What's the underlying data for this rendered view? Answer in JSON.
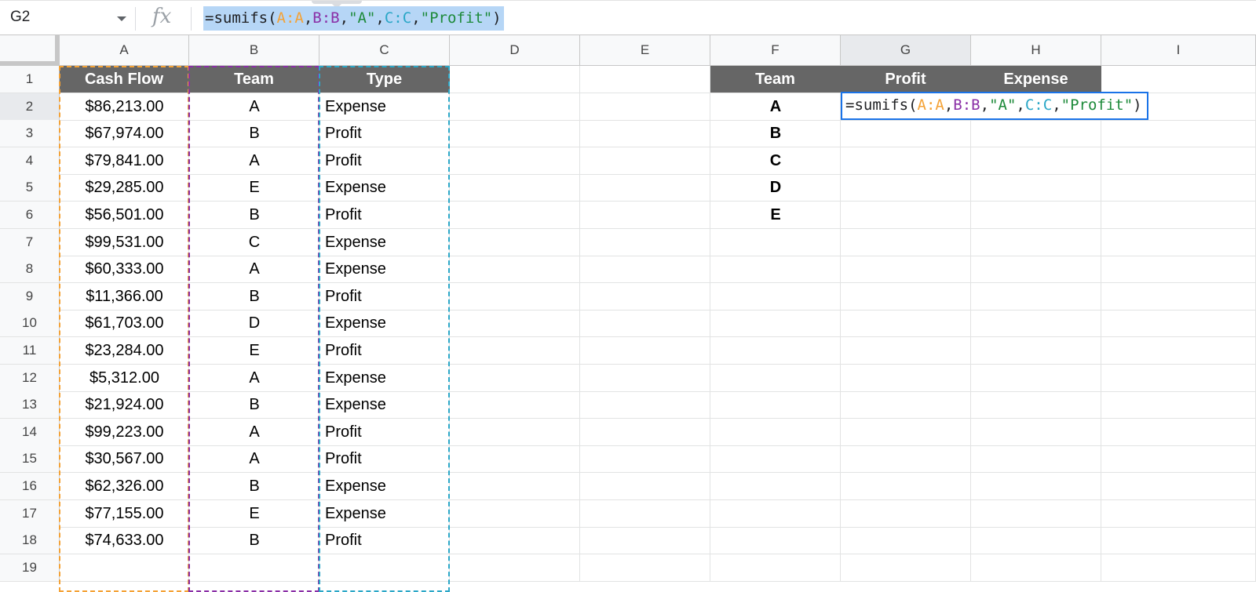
{
  "formula_bar": {
    "cell_ref": "G2",
    "fx_label": "fx",
    "formula_parts": [
      {
        "text": "=sumifs(",
        "color": "bk"
      },
      {
        "text": "A:A",
        "color": "or"
      },
      {
        "text": ",",
        "color": "bk"
      },
      {
        "text": "B:B",
        "color": "pu"
      },
      {
        "text": ",",
        "color": "bk"
      },
      {
        "text": "\"A\"",
        "color": "gr"
      },
      {
        "text": ",",
        "color": "bk"
      },
      {
        "text": "C:C",
        "color": "tl"
      },
      {
        "text": ",",
        "color": "bk"
      },
      {
        "text": "\"Profit\"",
        "color": "gr"
      },
      {
        "text": ")",
        "color": "bk"
      }
    ]
  },
  "colors": {
    "header_fill": "#666666",
    "range_a": "#f4a236",
    "range_b": "#8a2fa6",
    "range_c": "#2ba7c7",
    "active": "#1a73e8"
  },
  "columns": [
    "A",
    "B",
    "C",
    "D",
    "E",
    "F",
    "G",
    "H",
    "I"
  ],
  "selected_column": "G",
  "rows": [
    "1",
    "2",
    "3",
    "4",
    "5",
    "6",
    "7",
    "8",
    "9",
    "10",
    "11",
    "12",
    "13",
    "14",
    "15",
    "16",
    "17",
    "18",
    "19"
  ],
  "selected_row": "2",
  "data_headers": [
    "Cash Flow",
    "Team",
    "Type"
  ],
  "data_rows": [
    [
      "$86,213.00",
      "A",
      "Expense"
    ],
    [
      "$67,974.00",
      "B",
      "Profit"
    ],
    [
      "$79,841.00",
      "A",
      "Profit"
    ],
    [
      "$29,285.00",
      "E",
      "Expense"
    ],
    [
      "$56,501.00",
      "B",
      "Profit"
    ],
    [
      "$99,531.00",
      "C",
      "Expense"
    ],
    [
      "$60,333.00",
      "A",
      "Expense"
    ],
    [
      "$11,366.00",
      "B",
      "Profit"
    ],
    [
      "$61,703.00",
      "D",
      "Expense"
    ],
    [
      "$23,284.00",
      "E",
      "Profit"
    ],
    [
      "$5,312.00",
      "A",
      "Expense"
    ],
    [
      "$21,924.00",
      "B",
      "Expense"
    ],
    [
      "$99,223.00",
      "A",
      "Profit"
    ],
    [
      "$30,567.00",
      "A",
      "Profit"
    ],
    [
      "$62,326.00",
      "B",
      "Expense"
    ],
    [
      "$77,155.00",
      "E",
      "Expense"
    ],
    [
      "$74,633.00",
      "B",
      "Profit"
    ]
  ],
  "summary_headers": [
    "Team",
    "Profit",
    "Expense"
  ],
  "summary_teams": [
    "A",
    "B",
    "C",
    "D",
    "E"
  ]
}
